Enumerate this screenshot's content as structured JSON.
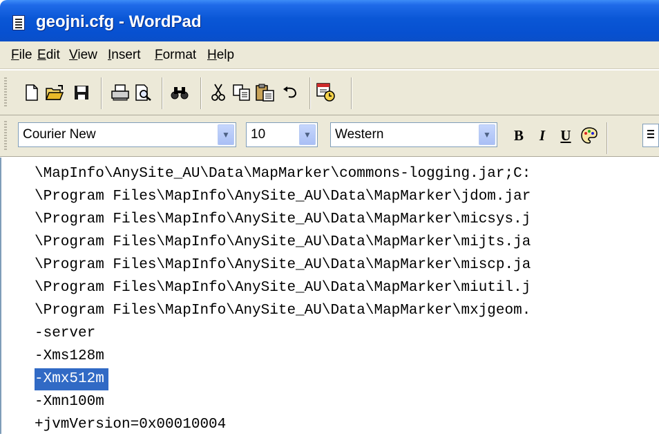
{
  "window": {
    "title": "geojni.cfg - WordPad"
  },
  "menu": {
    "items": [
      "File",
      "Edit",
      "View",
      "Insert",
      "Format",
      "Help"
    ]
  },
  "toolbar": {
    "buttons": [
      "new-icon",
      "open-icon",
      "save-icon",
      "print-icon",
      "print-preview-icon",
      "find-icon",
      "cut-icon",
      "copy-icon",
      "paste-icon",
      "undo-icon",
      "date-time-icon"
    ]
  },
  "format_bar": {
    "font": "Courier New",
    "size": "10",
    "script": "Western",
    "bold": "B",
    "italic": "I",
    "underline": "U"
  },
  "document": {
    "lines": [
      "\\MapInfo\\AnySite_AU\\Data\\MapMarker\\commons-logging.jar;C:",
      "\\Program Files\\MapInfo\\AnySite_AU\\Data\\MapMarker\\jdom.jar",
      "\\Program Files\\MapInfo\\AnySite_AU\\Data\\MapMarker\\micsys.j",
      "\\Program Files\\MapInfo\\AnySite_AU\\Data\\MapMarker\\mijts.ja",
      "\\Program Files\\MapInfo\\AnySite_AU\\Data\\MapMarker\\miscp.ja",
      "\\Program Files\\MapInfo\\AnySite_AU\\Data\\MapMarker\\miutil.j",
      "\\Program Files\\MapInfo\\AnySite_AU\\Data\\MapMarker\\mxjgeom.",
      "-server",
      "-Xms128m",
      "-Xmx512m",
      "-Xmn100m",
      "+jvmVersion=0x00010004"
    ],
    "selected_line": 9
  }
}
